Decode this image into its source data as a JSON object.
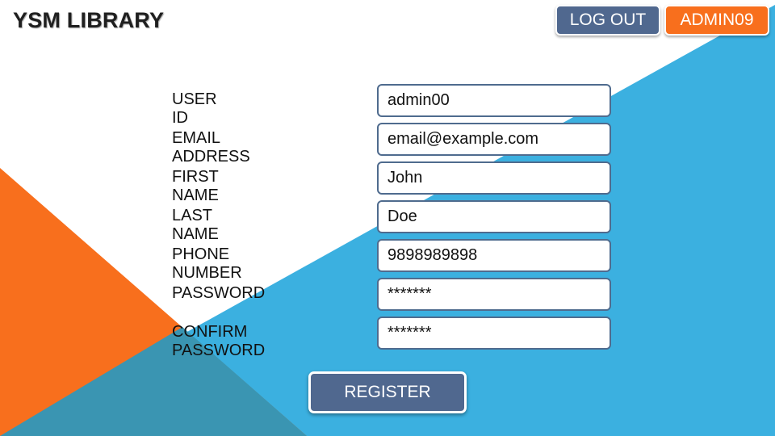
{
  "app": {
    "brand": "YSM LIBRARY"
  },
  "header": {
    "logout_label": "LOG OUT",
    "user_label": "ADMIN09"
  },
  "form": {
    "fields": [
      {
        "label": "USER ID",
        "value": "admin00"
      },
      {
        "label": "EMAIL ADDRESS",
        "value": "email@example.com"
      },
      {
        "label": "FIRST NAME",
        "value": "John"
      },
      {
        "label": "LAST NAME",
        "value": "Doe"
      },
      {
        "label": "PHONE NUMBER",
        "value": "9898989898"
      },
      {
        "label": "PASSWORD",
        "value": "*******"
      },
      {
        "label": "CONFIRM PASSWORD",
        "value": "*******"
      }
    ],
    "submit_label": "REGISTER"
  },
  "colors": {
    "accent_blue": "#3bb0e0",
    "accent_orange": "#f86f1d",
    "button_slate": "#50688f",
    "teal_overlap": "#3a95b2"
  }
}
